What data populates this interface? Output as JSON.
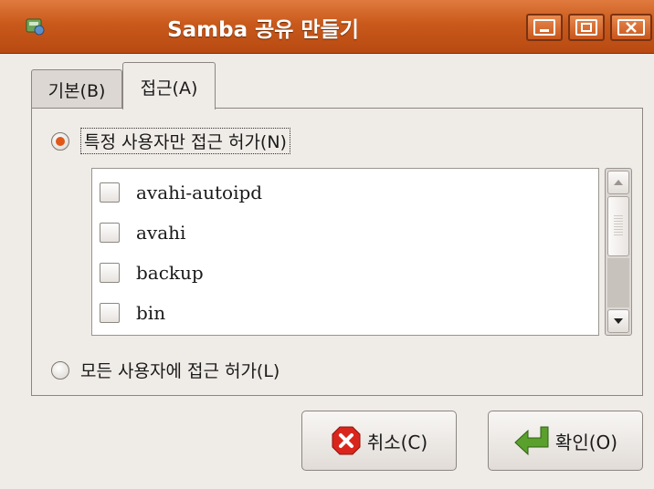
{
  "window": {
    "title": "Samba 공유 만들기",
    "buttons": [
      "minimize",
      "maximize",
      "close"
    ]
  },
  "tabs": [
    {
      "label": "기본(B)",
      "selected": false
    },
    {
      "label": "접근(A)",
      "selected": true
    }
  ],
  "access": {
    "specific_users_label": "특정 사용자만 접근 허가(N)",
    "specific_users_selected": true,
    "all_users_label": "모든 사용자에 접근 허가(L)",
    "all_users_selected": false
  },
  "users": [
    {
      "name": "avahi-autoipd",
      "checked": false
    },
    {
      "name": "avahi",
      "checked": false
    },
    {
      "name": "backup",
      "checked": false
    },
    {
      "name": "bin",
      "checked": false
    }
  ],
  "buttons": {
    "cancel": "취소(C)",
    "ok": "확인(O)"
  },
  "colors": {
    "titlebar": "#c9591b",
    "window_bg": "#efebe7",
    "radio_accent": "#e0571a",
    "cancel_icon": "#d9261c",
    "ok_icon": "#5aa02c"
  },
  "icons": {
    "app": "samba-share-icon",
    "cancel": "cancel-icon",
    "ok": "ok-arrow-icon"
  }
}
